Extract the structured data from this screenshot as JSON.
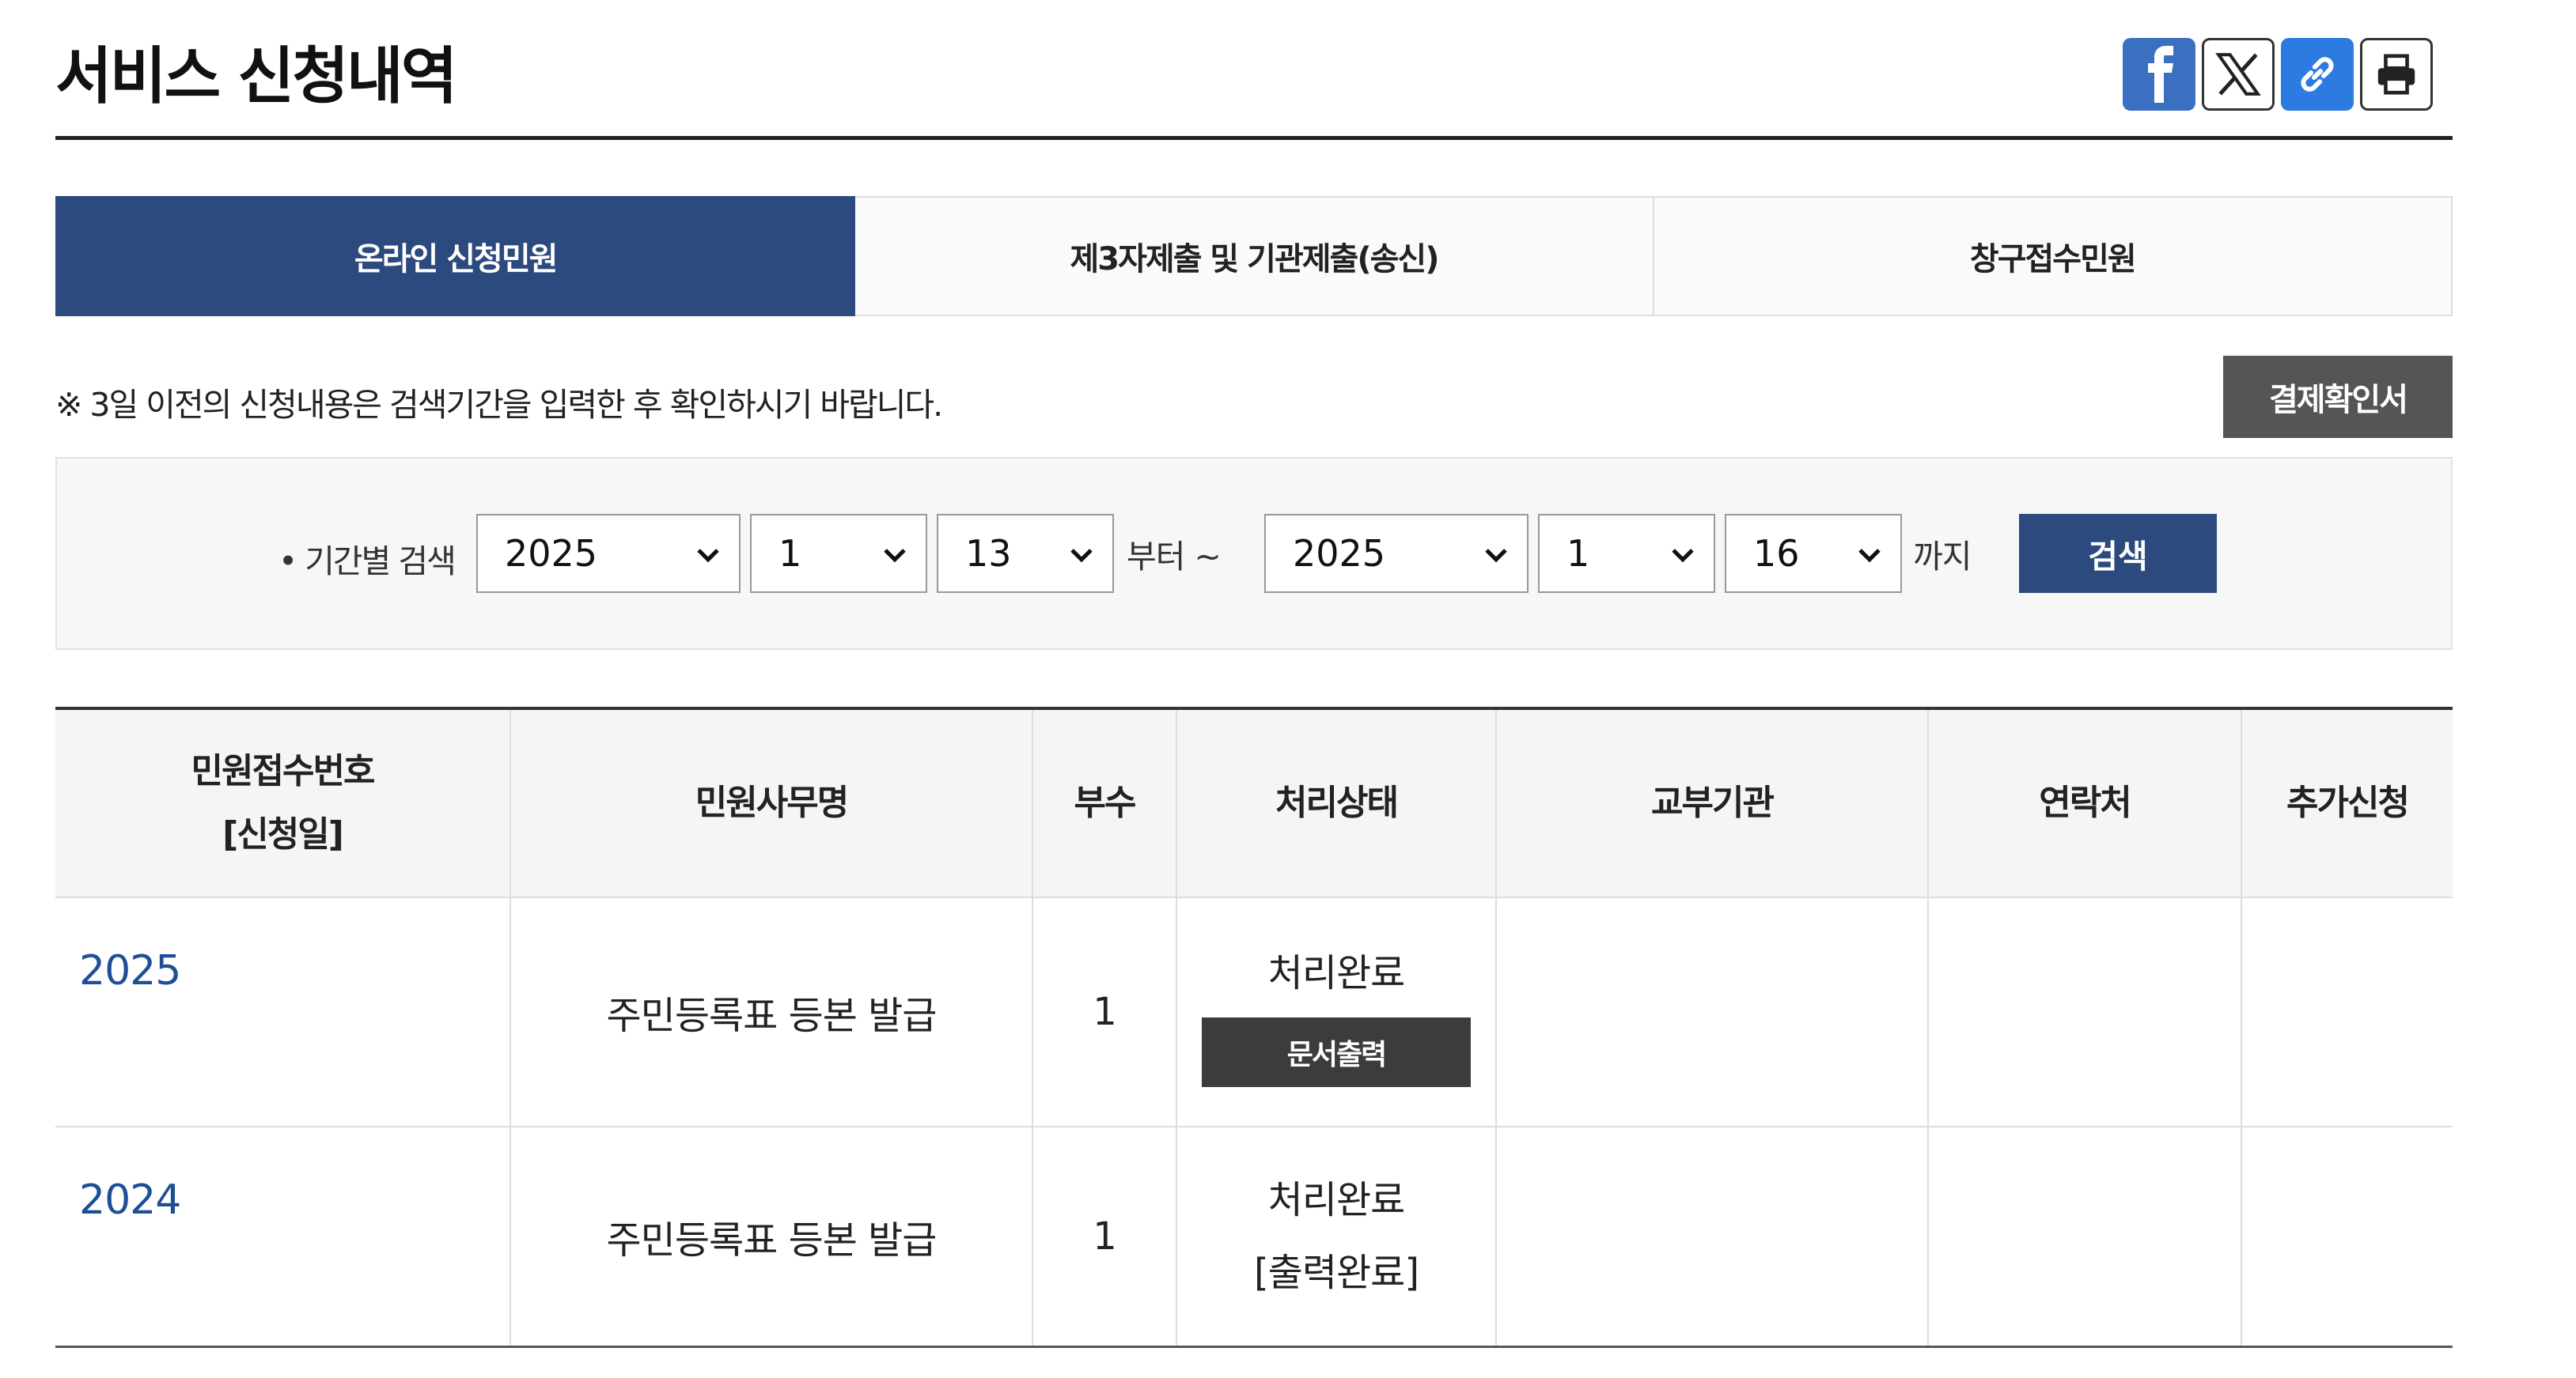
{
  "page": {
    "title": "서비스 신청내역"
  },
  "share": {
    "facebook_icon": "facebook-icon",
    "x_icon": "x-twitter-icon",
    "link_icon": "link-icon",
    "print_icon": "print-icon",
    "colors": {
      "facebook": "#3b6fc0",
      "link": "#2b7be0"
    }
  },
  "tabs": [
    {
      "label": "온라인 신청민원",
      "active": true
    },
    {
      "label": "제3자제출 및 기관제출(송신)",
      "active": false
    },
    {
      "label": "창구접수민원",
      "active": false
    }
  ],
  "notice": "※ 3일 이전의 신청내용은 검색기간을 입력한 후 확인하시기 바랍니다.",
  "receipt_button": "결제확인서",
  "search": {
    "label": "• 기간별 검색",
    "from_year": "2025",
    "from_month": "1",
    "from_day": "13",
    "from_text": "부터 ~",
    "to_year": "2025",
    "to_month": "1",
    "to_day": "16",
    "to_text": "까지",
    "button": "검색"
  },
  "table": {
    "headers": {
      "app_no_line1": "민원접수번호",
      "app_no_line2": "[신청일]",
      "service": "민원사무명",
      "copies": "부수",
      "status": "처리상태",
      "agency": "교부기관",
      "contact": "연락처",
      "extra": "추가신청"
    },
    "rows": [
      {
        "app_no": "2025",
        "service": "주민등록표 등본 발급",
        "copies": "1",
        "status": "처리완료",
        "action": "문서출력"
      },
      {
        "app_no": "2024",
        "service": "주민등록표 등본 발급",
        "copies": "1",
        "status": "처리완료",
        "status_detail": "[출력완료]"
      }
    ]
  },
  "colors": {
    "primary": "#2c4a7e",
    "link": "#1e4f96",
    "dark_button": "#3c3c3c",
    "gray_button": "#555555"
  }
}
